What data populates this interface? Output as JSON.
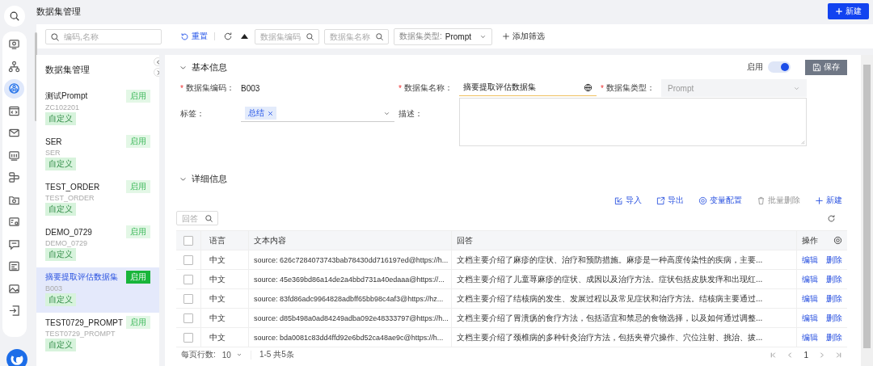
{
  "nav_rail": {
    "items": [
      {
        "kind": "monitor",
        "selected": false
      },
      {
        "kind": "hierarchy",
        "selected": false
      },
      {
        "kind": "dataset",
        "selected": true
      },
      {
        "kind": "code",
        "selected": false
      },
      {
        "kind": "mail",
        "selected": false
      },
      {
        "kind": "chart",
        "selected": false
      },
      {
        "kind": "flow",
        "selected": false
      },
      {
        "kind": "folder",
        "selected": false
      },
      {
        "kind": "image",
        "selected": false
      },
      {
        "kind": "chat",
        "selected": false
      },
      {
        "kind": "form",
        "selected": false
      },
      {
        "kind": "picture",
        "selected": false
      },
      {
        "kind": "login",
        "selected": false
      }
    ]
  },
  "page_title": "数据集管理",
  "new_button": "新建",
  "filter_bar": {
    "keyword_search": {
      "placeholder": "编码,名称"
    },
    "reset": "重置",
    "filters": [
      {
        "placeholder": "数据集编码"
      },
      {
        "placeholder": "数据集名称"
      }
    ],
    "type_filter": {
      "label": "数据集类型:",
      "value": "Prompt"
    },
    "add_filter": "添加筛选"
  },
  "dataset_list": {
    "title": "数据集管理",
    "items": [
      {
        "name": "测试Prompt",
        "code": "ZC102201",
        "status": "启用",
        "tag": "自定义",
        "selected": false
      },
      {
        "name": "SER",
        "code": "SER",
        "status": "启用",
        "tag": "自定义",
        "selected": false
      },
      {
        "name": "TEST_ORDER",
        "code": "TEST_ORDER",
        "status": "启用",
        "tag": "自定义",
        "selected": false
      },
      {
        "name": "DEMO_0729",
        "code": "DEMO_0729",
        "status": "启用",
        "tag": "自定义",
        "selected": false
      },
      {
        "name": "摘要提取评估数据集",
        "code": "B003",
        "status": "启用",
        "tag": "自定义",
        "selected": true
      },
      {
        "name": "TEST0729_PROMPT",
        "code": "TEST0729_PROMPT",
        "status": "启用",
        "tag": "自定义",
        "selected": false
      }
    ]
  },
  "basic_info": {
    "title": "基本信息",
    "expanded": true,
    "enabled_label": "启用",
    "enabled_on": true,
    "save": "保存",
    "code": {
      "label": "数据集编码：",
      "required_mark": "*",
      "value": "B003"
    },
    "name": {
      "label": "数据集名称：",
      "required_mark": "*",
      "value": "摘要提取评估数据集"
    },
    "type": {
      "label": "数据集类型：",
      "required_mark": "*",
      "value": "Prompt",
      "disabled": true
    },
    "tags": {
      "label": "标签：",
      "values": [
        "总结"
      ]
    },
    "description": {
      "label": "描述："
    }
  },
  "details": {
    "title": "详细信息",
    "expanded": true,
    "actions": [
      {
        "kind": "import",
        "label": "导入",
        "disabled": false
      },
      {
        "kind": "export",
        "label": "导出",
        "disabled": false
      },
      {
        "kind": "variables",
        "label": "变量配置",
        "disabled": false
      },
      {
        "kind": "delete",
        "label": "批量删除",
        "disabled": true
      },
      {
        "kind": "add",
        "label": "新建",
        "disabled": false
      }
    ],
    "search": {
      "placeholder": "回答"
    },
    "table": {
      "all_checked": false,
      "columns": [
        "语言",
        "文本内容",
        "回答",
        "操作"
      ],
      "rows": [
        {
          "checked": false,
          "language": "中文",
          "text": "source: 626c7284073743bab78430dd716197ed@https://h...",
          "answer": "文档主要介绍了麻疹的症状、治疗和预防措施。麻疹是一种高度传染性的疾病，主要...",
          "actions": [
            "编辑",
            "删除"
          ]
        },
        {
          "checked": false,
          "language": "中文",
          "text": "source: 45e369bd86a14de2a4bbd731a40edaaa@https://...",
          "answer": "文档主要介绍了儿童荨麻疹的症状、成因以及治疗方法。症状包括皮肤发痒和出现红...",
          "actions": [
            "编辑",
            "删除"
          ]
        },
        {
          "checked": false,
          "language": "中文",
          "text": "source: 83fd86adc9964828adbff65bb98c4af3@https://hz...",
          "answer": "文档主要介绍了结核病的发生、发展过程以及常见症状和治疗方法。结核病主要通过...",
          "actions": [
            "编辑",
            "删除"
          ]
        },
        {
          "checked": false,
          "language": "中文",
          "text": "source: d85b498a0ad84249adba092e48333797@https://h...",
          "answer": "文档主要介绍了胃溃疡的食疗方法，包括适宜和禁忌的食物选择，以及如何通过调整...",
          "actions": [
            "编辑",
            "删除"
          ]
        },
        {
          "checked": false,
          "language": "中文",
          "text": "source: bda0081c83dd4ffd92e6bd52ca48ae9c@https://h...",
          "answer": "文档主要介绍了颈椎病的多种针灸治疗方法，包括夹脊穴操作、穴位注射、挑治、拔...",
          "actions": [
            "编辑",
            "删除"
          ]
        }
      ]
    },
    "pagination": {
      "rows_per_page_label": "每页行数:",
      "page_size": "10",
      "range": "1-5 共5条",
      "current_page": "1"
    }
  }
}
